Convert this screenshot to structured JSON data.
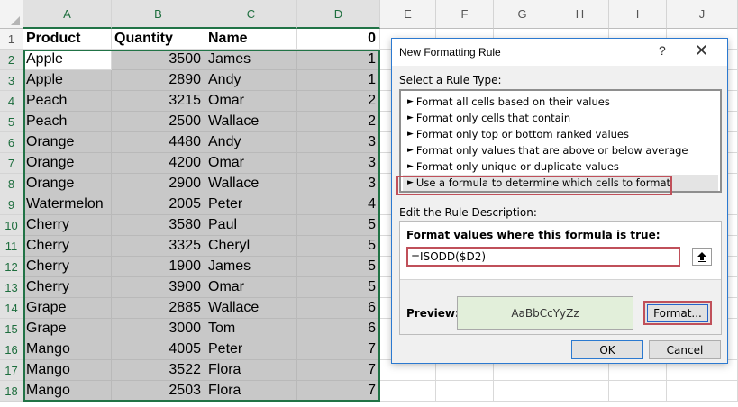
{
  "sheet": {
    "columns": [
      "A",
      "B",
      "C",
      "D",
      "E",
      "F",
      "G",
      "H",
      "I",
      "J"
    ],
    "row_numbers": [
      "1",
      "2",
      "3",
      "4",
      "5",
      "6",
      "7",
      "8",
      "9",
      "10",
      "11",
      "12",
      "13",
      "14",
      "15",
      "16",
      "17",
      "18"
    ],
    "header": [
      "Product",
      "Quantity",
      "Name",
      "0"
    ],
    "rows": [
      [
        "Apple",
        "3500",
        "James",
        "1"
      ],
      [
        "Apple",
        "2890",
        "Andy",
        "1"
      ],
      [
        "Peach",
        "3215",
        "Omar",
        "2"
      ],
      [
        "Peach",
        "2500",
        "Wallace",
        "2"
      ],
      [
        "Orange",
        "4480",
        "Andy",
        "3"
      ],
      [
        "Orange",
        "4200",
        "Omar",
        "3"
      ],
      [
        "Orange",
        "2900",
        "Wallace",
        "3"
      ],
      [
        "Watermelon",
        "2005",
        "Peter",
        "4"
      ],
      [
        "Cherry",
        "3580",
        "Paul",
        "5"
      ],
      [
        "Cherry",
        "3325",
        "Cheryl",
        "5"
      ],
      [
        "Cherry",
        "1900",
        "James",
        "5"
      ],
      [
        "Cherry",
        "3900",
        "Omar",
        "5"
      ],
      [
        "Grape",
        "2885",
        "Wallace",
        "6"
      ],
      [
        "Grape",
        "3000",
        "Tom",
        "6"
      ],
      [
        "Mango",
        "4005",
        "Peter",
        "7"
      ],
      [
        "Mango",
        "3522",
        "Flora",
        "7"
      ],
      [
        "Mango",
        "2503",
        "Flora",
        "7"
      ]
    ],
    "selection_color": "#217346",
    "shade_color": "#c8c8c8"
  },
  "dialog": {
    "title": "New Formatting Rule",
    "help": "?",
    "close": "✕",
    "select_rule_label": "Select a Rule Type:",
    "rule_types": [
      "Format all cells based on their values",
      "Format only cells that contain",
      "Format only top or bottom ranked values",
      "Format only values that are above or below average",
      "Format only unique or duplicate values",
      "Use a formula to determine which cells to format"
    ],
    "selected_rule_index": 5,
    "edit_label": "Edit the Rule Description:",
    "formula_label": "Format values where this formula is true:",
    "formula_value": "=ISODD($D2)",
    "preview_label": "Preview:",
    "preview_text": "AaBbCcYyZz",
    "preview_color": "#e2efda",
    "format_button": "Format...",
    "ok_button": "OK",
    "cancel_button": "Cancel",
    "highlight_color": "#c0505a"
  }
}
